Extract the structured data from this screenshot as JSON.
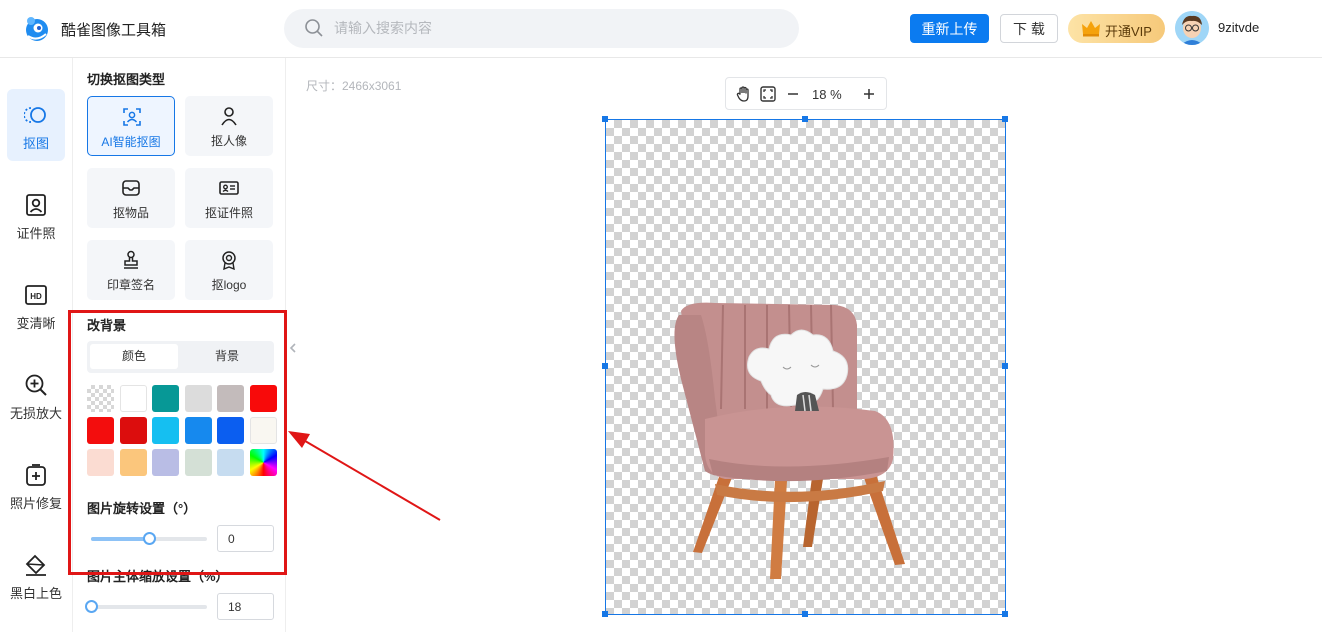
{
  "app": {
    "title": "酷雀图像工具箱"
  },
  "search": {
    "placeholder": "请输入搜索内容",
    "value": ""
  },
  "header": {
    "reupload_label": "重新上传",
    "download_label": "下 载",
    "vip_label": "开通VIP",
    "username": "9zitvde"
  },
  "nav": {
    "items": [
      {
        "label": "抠图",
        "icon": "cutout-icon",
        "active": true
      },
      {
        "label": "证件照",
        "icon": "id-photo-icon",
        "active": false
      },
      {
        "label": "变清晰",
        "icon": "hd-icon",
        "active": false
      },
      {
        "label": "无损放大",
        "icon": "zoom-in-icon",
        "active": false
      },
      {
        "label": "照片修复",
        "icon": "photo-repair-icon",
        "active": false
      },
      {
        "label": "黑白上色",
        "icon": "paint-bucket-icon",
        "active": false
      }
    ]
  },
  "panel": {
    "type_title": "切换抠图类型",
    "types": [
      {
        "label": "AI智能抠图",
        "icon": "ai-cutout-icon",
        "active": true
      },
      {
        "label": "抠人像",
        "icon": "person-icon",
        "active": false
      },
      {
        "label": "抠物品",
        "icon": "object-icon",
        "active": false
      },
      {
        "label": "抠证件照",
        "icon": "id-card-icon",
        "active": false
      },
      {
        "label": "印章签名",
        "icon": "stamp-icon",
        "active": false
      },
      {
        "label": "抠logo",
        "icon": "logo-badge-icon",
        "active": false
      }
    ],
    "bg_title": "改背景",
    "bg_tabs": [
      "颜色",
      "背景"
    ],
    "bg_tab_selected": 0,
    "swatches": [
      "transparent",
      "#ffffff",
      "#079896",
      "#dcdcdc",
      "#c3bbbb",
      "#f80a0a",
      "#f30d0d",
      "#dc0d0d",
      "#15bff1",
      "#1689ee",
      "#0b5ef0",
      "#f9f7f1",
      "#fbdcd2",
      "#fbc67c",
      "#b9bde5",
      "#d4e0d6",
      "#c6dcf0",
      "gradient"
    ],
    "rotate_title": "图片旋转设置（°）",
    "rotate_value": "0",
    "rotate_fraction": 0.5,
    "scale_title": "图片主体缩放设置（%）",
    "scale_value": "18",
    "scale_fraction": 0.0
  },
  "canvas": {
    "size_text": "尺寸：2466x3061",
    "zoom_text": "18 %"
  },
  "colors": {
    "accent": "#1677e6",
    "highlight": "#e01616"
  }
}
